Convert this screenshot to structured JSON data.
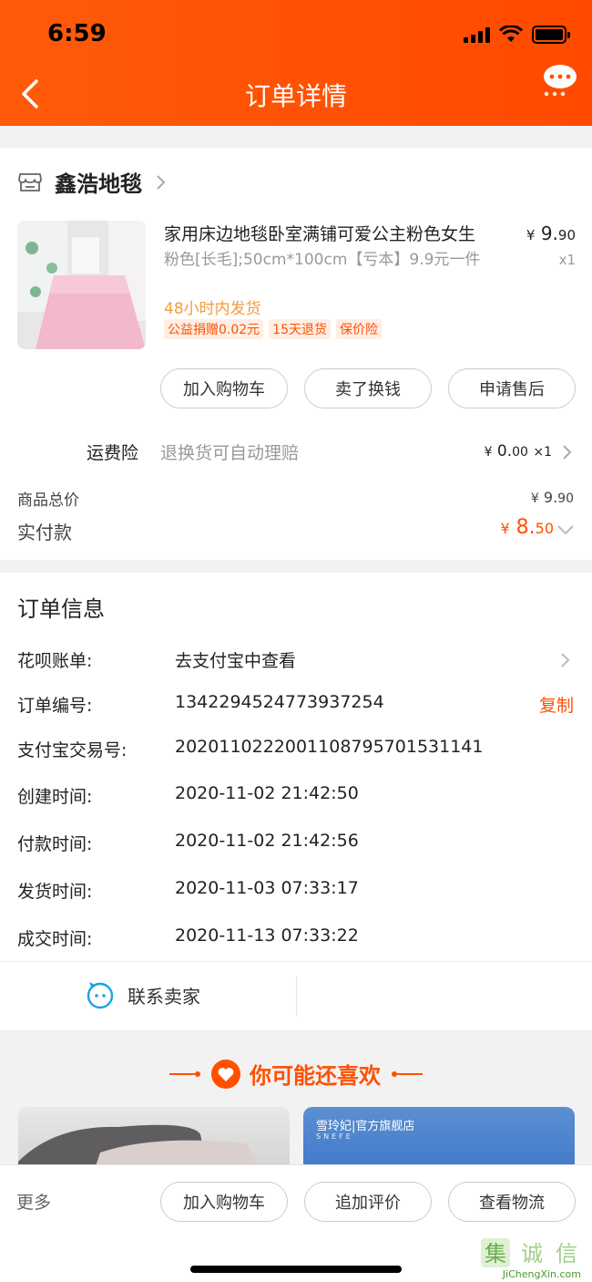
{
  "status": {
    "time": "6:59"
  },
  "header": {
    "title": "订单详情",
    "back_icon": "chevron-left-icon",
    "chat_icon": "chat-bubble-icon",
    "bg_color": "#ff5000"
  },
  "shop": {
    "name": "鑫浩地毯",
    "product": {
      "title": "家用床边地毯卧室满铺可爱公主粉色女生",
      "sku": "粉色[长毛];50cm*100cm【亏本】9.9元一件",
      "ship_note": "48小时内发货",
      "tags": [
        "公益捐赠0.02元",
        "15天退货",
        "保价险"
      ],
      "price_symbol": "¥",
      "price_int": "9.",
      "price_dec": "90",
      "qty": "x1"
    },
    "buttons": [
      "加入购物车",
      "卖了换钱",
      "申请售后"
    ],
    "insurance": {
      "label": "运费险",
      "desc": "退换货可自动理赔",
      "price_symbol": "¥",
      "price_int": "0.",
      "price_dec": "00",
      "qty": "×1"
    },
    "total": {
      "label": "商品总价",
      "symbol": "¥",
      "int": "9.",
      "dec": "90"
    },
    "paid": {
      "label": "实付款",
      "symbol": "¥",
      "int": "8.",
      "dec": "50"
    }
  },
  "order": {
    "title": "订单信息",
    "rows": [
      {
        "label": "花呗账单:",
        "value": "去支付宝中查看"
      },
      {
        "label": "订单编号:",
        "value": "1342294524773937254",
        "action": "复制"
      },
      {
        "label": "支付宝交易号:",
        "value": "2020110222001108795701531141"
      },
      {
        "label": "创建时间:",
        "value": "2020-11-02 21:42:50"
      },
      {
        "label": "付款时间:",
        "value": "2020-11-02 21:42:56"
      },
      {
        "label": "发货时间:",
        "value": "2020-11-03 07:33:17"
      },
      {
        "label": "成交时间:",
        "value": "2020-11-13 07:33:22"
      }
    ],
    "contact": "联系卖家"
  },
  "recommend": {
    "title": "你可能还喜欢",
    "brand": "雪玲妃|官方旗舰店",
    "brand_sub": "SNEFE"
  },
  "bottom": {
    "more": "更多",
    "buttons": [
      "加入购物车",
      "追加评价",
      "查看物流"
    ]
  },
  "watermark": {
    "site": "JiChengXin.com",
    "text": "集诚信"
  }
}
